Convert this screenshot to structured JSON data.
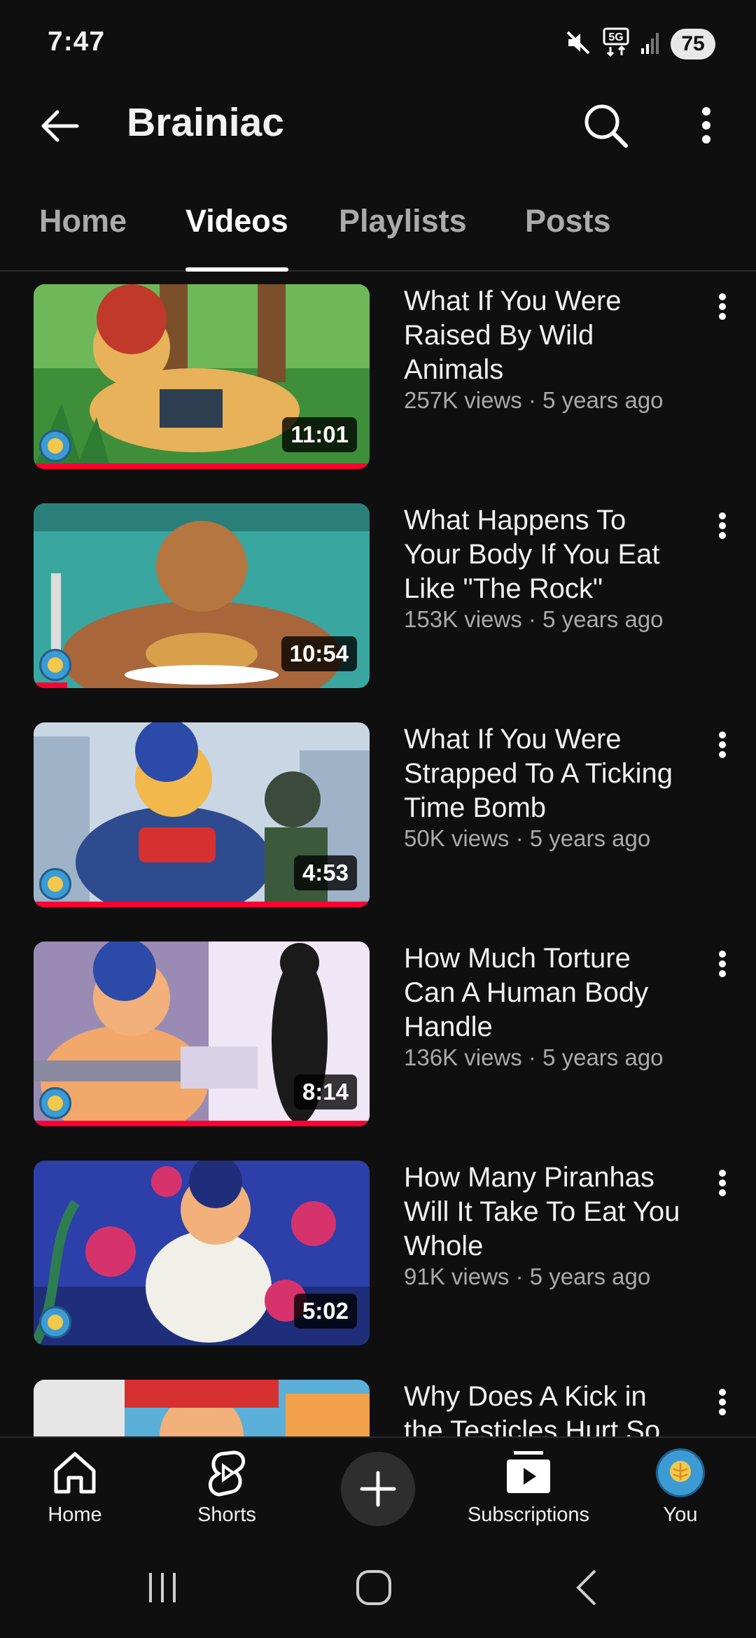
{
  "status_bar": {
    "time": "7:47",
    "network": "5G",
    "battery": "75",
    "icons": [
      "mute-icon",
      "5g-icon",
      "signal-icon",
      "battery-icon"
    ]
  },
  "header": {
    "title": "Brainiac",
    "icons": [
      "back-arrow-icon",
      "search-icon",
      "more-vert-icon"
    ]
  },
  "tabs": [
    {
      "label": "Home",
      "active": false
    },
    {
      "label": "Videos",
      "active": true
    },
    {
      "label": "Playlists",
      "active": false
    },
    {
      "label": "Posts",
      "active": false
    }
  ],
  "videos": [
    {
      "title": "What If You Were Raised By Wild Animals",
      "meta": "257K views · 5 years ago",
      "duration": "11:01",
      "watched_fraction": 1.0
    },
    {
      "title": "What Happens To Your Body If You Eat Like \"The Rock\"",
      "meta": "153K views · 5 years ago",
      "duration": "10:54",
      "watched_fraction": 0.1
    },
    {
      "title": "What If You Were Strapped To A Ticking Time Bomb",
      "meta": "50K views · 5 years ago",
      "duration": "4:53",
      "watched_fraction": 1.0
    },
    {
      "title": "How Much Torture Can A Human Body Handle",
      "meta": "136K views · 5 years ago",
      "duration": "8:14",
      "watched_fraction": 1.0
    },
    {
      "title": "How Many Piranhas Will It Take To Eat You Whole",
      "meta": "91K views · 5 years ago",
      "duration": "5:02",
      "watched_fraction": 0
    },
    {
      "title": "Why Does A Kick in the Testicles Hurt So",
      "meta": "",
      "duration": "",
      "watched_fraction": 0
    }
  ],
  "bottom_nav": {
    "items": [
      {
        "label": "Home",
        "icon": "home-icon"
      },
      {
        "label": "Shorts",
        "icon": "shorts-icon"
      },
      {
        "label": "",
        "icon": "plus-icon"
      },
      {
        "label": "Subscriptions",
        "icon": "subscriptions-icon"
      },
      {
        "label": "You",
        "icon": "avatar-icon"
      }
    ]
  },
  "system_nav": [
    "recent-apps-icon",
    "home-circle-icon",
    "back-chevron-icon"
  ],
  "colors": {
    "background": "#0f0f0f",
    "text": "#f1f1f1",
    "secondary_text": "#aaaaaa",
    "progress": "#ff0033"
  }
}
